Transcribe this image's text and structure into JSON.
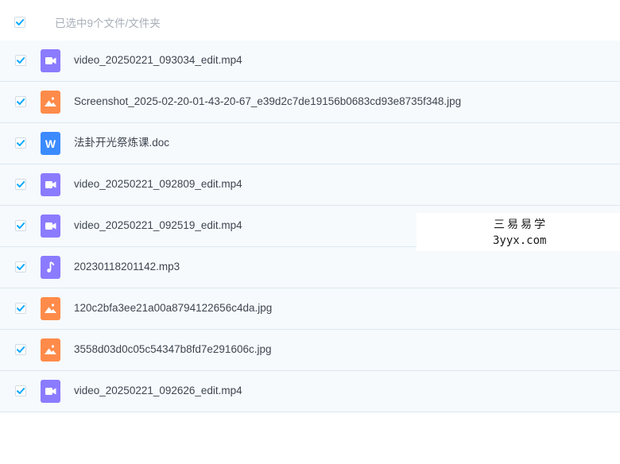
{
  "header": {
    "title": "已选中9个文件/文件夹",
    "select_all_checked": true
  },
  "colors": {
    "checkbox_check": "#06a7ff",
    "video_icon": "#8b7bff",
    "image_icon": "#ff8b4a",
    "doc_icon": "#3b8bff",
    "audio_icon": "#8b7bff",
    "row_background": "#f6fafd",
    "header_text": "#a9b0b8",
    "file_text": "#3f4650"
  },
  "files": [
    {
      "name": "video_20250221_093034_edit.mp4",
      "type": "video",
      "icon": "video-file-icon",
      "checked": true
    },
    {
      "name": "Screenshot_2025-02-20-01-43-20-67_e39d2c7de19156b0683cd93e8735f348.jpg",
      "type": "image",
      "icon": "image-file-icon",
      "checked": true
    },
    {
      "name": "法卦开光祭炼课.doc",
      "type": "doc",
      "icon": "word-doc-icon",
      "icon_letter": "W",
      "checked": true
    },
    {
      "name": "video_20250221_092809_edit.mp4",
      "type": "video",
      "icon": "video-file-icon",
      "checked": true
    },
    {
      "name": "video_20250221_092519_edit.mp4",
      "type": "video",
      "icon": "video-file-icon",
      "checked": true
    },
    {
      "name": "20230118201142.mp3",
      "type": "audio",
      "icon": "audio-file-icon",
      "checked": true
    },
    {
      "name": "120c2bfa3ee21a00a8794122656c4da.jpg",
      "type": "image",
      "icon": "image-file-icon",
      "checked": true
    },
    {
      "name": "3558d03d0c05c54347b8fd7e291606c.jpg",
      "type": "image",
      "icon": "image-file-icon",
      "checked": true
    },
    {
      "name": "video_20250221_092626_edit.mp4",
      "type": "video",
      "icon": "video-file-icon",
      "checked": true
    }
  ],
  "watermark": {
    "line1": "三易易学",
    "line2": "3yyx.com"
  }
}
